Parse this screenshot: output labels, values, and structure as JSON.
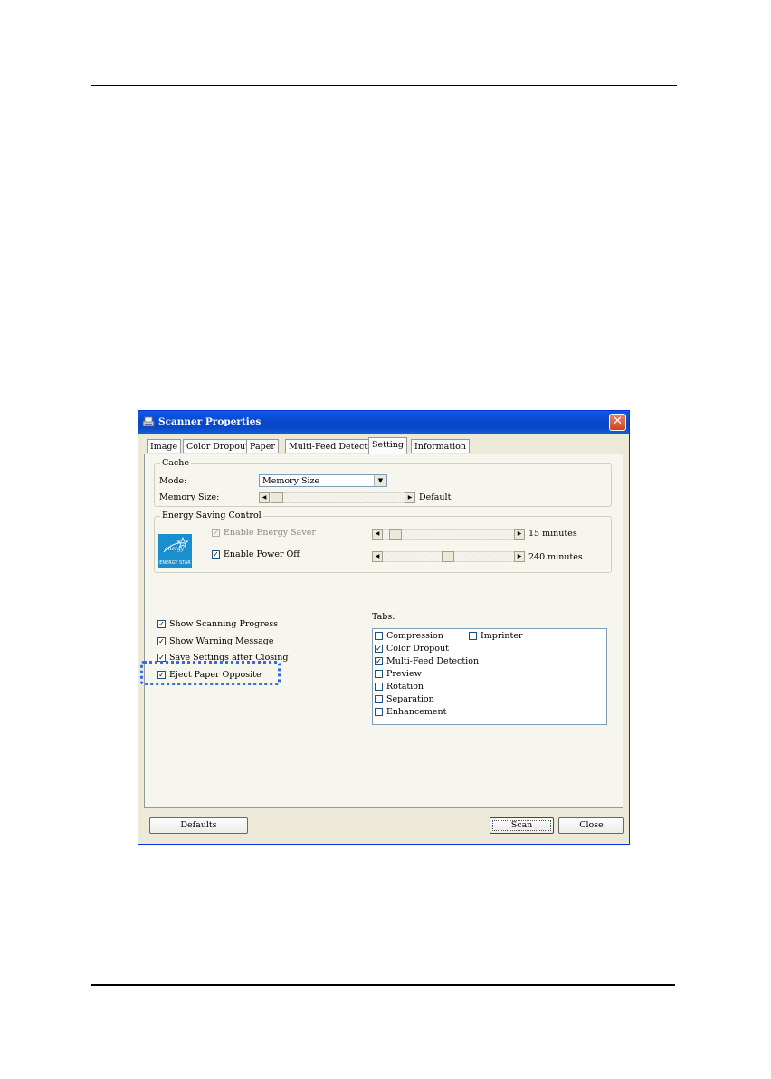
{
  "window": {
    "title": "Scanner Properties",
    "close_label": "✕"
  },
  "tabs": [
    {
      "label": "Image"
    },
    {
      "label": "Color Dropout"
    },
    {
      "label": "Paper"
    },
    {
      "label": "Multi-Feed Detection"
    },
    {
      "label": "Setting",
      "active": true
    },
    {
      "label": "Information"
    }
  ],
  "cache": {
    "group_label": "Cache",
    "mode_label": "Mode:",
    "mode_value": "Memory Size",
    "memory_size_label": "Memory Size:",
    "memory_size_value": "Default"
  },
  "energy": {
    "group_label": "Energy Saving Control",
    "logo_text": "ENERGY STAR",
    "energy_saver_label": "Enable Energy Saver",
    "energy_saver_checked": true,
    "energy_saver_enabled": false,
    "energy_saver_value": "15 minutes",
    "power_off_label": "Enable Power Off",
    "power_off_checked": true,
    "power_off_value": "240 minutes"
  },
  "options": {
    "show_scanning_progress": "Show Scanning Progress",
    "show_warning_message": "Show Warning Message",
    "save_settings_after_closing": "Save Settings after Closing",
    "eject_paper_opposite": "Eject Paper Opposite"
  },
  "tabs_list": {
    "label": "Tabs:",
    "items": [
      {
        "label": "Compression",
        "checked": false
      },
      {
        "label": "Imprinter",
        "checked": false
      },
      {
        "label": "Color Dropout",
        "checked": true
      },
      {
        "label": "Multi-Feed Detection",
        "checked": true
      },
      {
        "label": "Preview",
        "checked": false
      },
      {
        "label": "Rotation",
        "checked": false
      },
      {
        "label": "Separation",
        "checked": false
      },
      {
        "label": "Enhancement",
        "checked": false
      }
    ]
  },
  "buttons": {
    "defaults": "Defaults",
    "scan": "Scan",
    "close": "Close"
  },
  "check_mark": "✓",
  "colors": {
    "titlebar": "#0a48cf",
    "focus_highlight": "#2d6fe0",
    "dialog_bg": "#ece9d8"
  }
}
